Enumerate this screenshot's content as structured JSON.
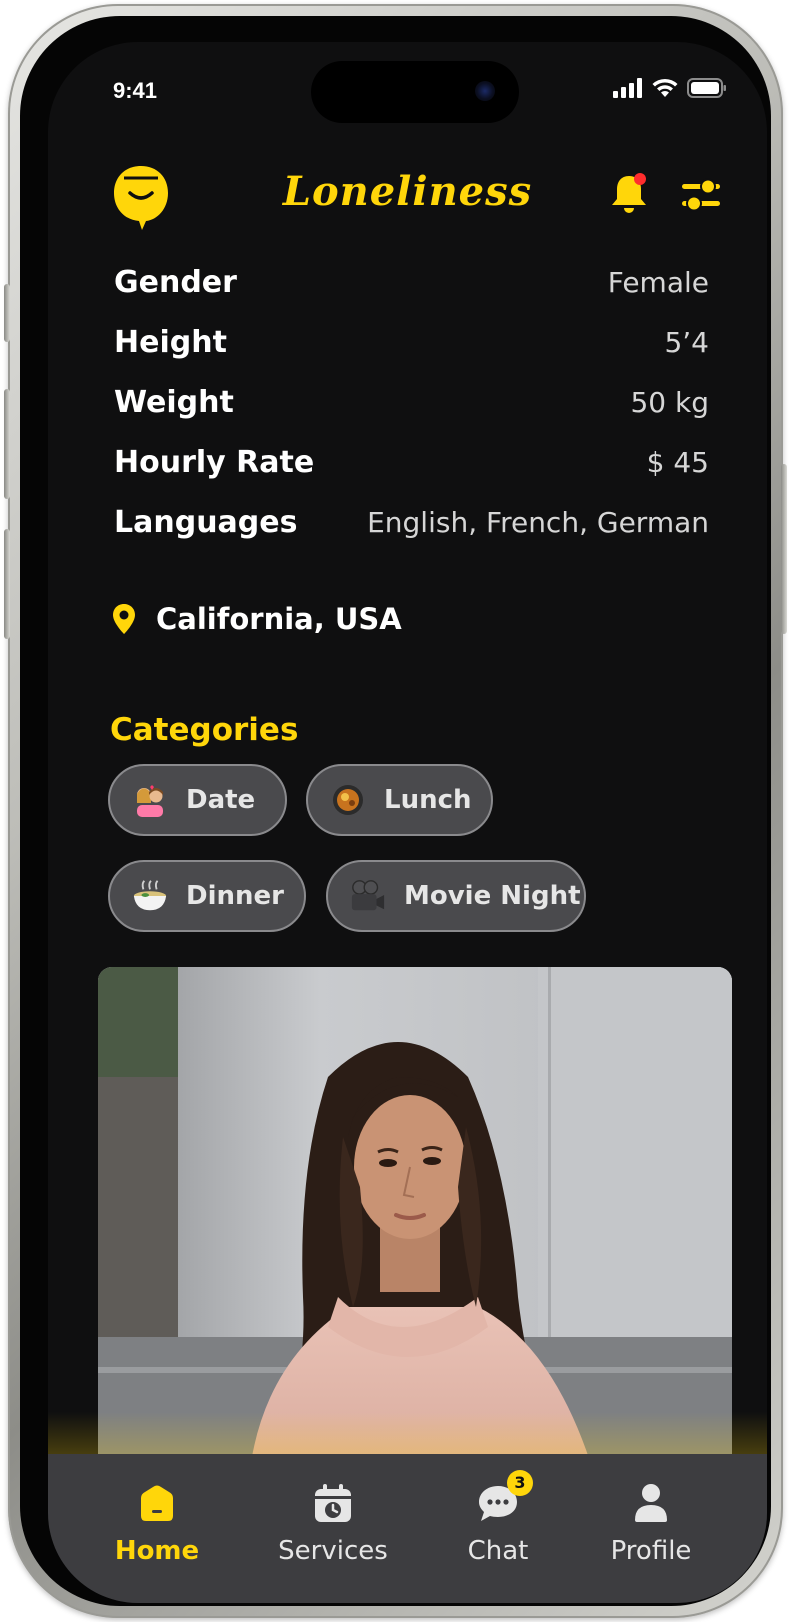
{
  "status_bar": {
    "time": "9:41"
  },
  "header": {
    "app_title": "Loneliness",
    "bell_notification_dot_color": "#ff2d2d",
    "accent_color": "#ffd60a"
  },
  "details": [
    {
      "label": "Gender",
      "value": "Female"
    },
    {
      "label": "Height",
      "value": "5’4"
    },
    {
      "label": "Weight",
      "value": "50 kg"
    },
    {
      "label": "Hourly Rate",
      "value": "$ 45"
    },
    {
      "label": "Languages",
      "value": "English, French, German"
    }
  ],
  "location": {
    "text": "California, USA",
    "icon": "map-pin-icon"
  },
  "categories": {
    "title": "Categories",
    "items": [
      {
        "label": "Date",
        "icon": "couple-emoji-icon"
      },
      {
        "label": "Lunch",
        "icon": "lunch-pan-emoji-icon"
      },
      {
        "label": "Dinner",
        "icon": "dinner-bowl-emoji-icon"
      },
      {
        "label": "Movie Night",
        "icon": "movie-camera-emoji-icon"
      }
    ]
  },
  "tabbar": {
    "items": [
      {
        "label": "Home",
        "icon": "home-icon",
        "active": true
      },
      {
        "label": "Services",
        "icon": "calendar-clock-icon",
        "active": false
      },
      {
        "label": "Chat",
        "icon": "chat-bubble-icon",
        "active": false,
        "badge": "3"
      },
      {
        "label": "Profile",
        "icon": "person-icon",
        "active": false
      }
    ]
  }
}
